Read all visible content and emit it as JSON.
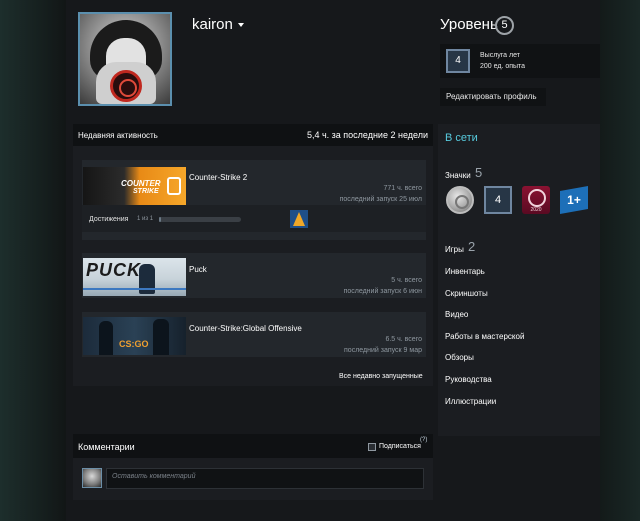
{
  "profile": {
    "username": "kairon",
    "level_label": "Уровень",
    "level": "5",
    "xp_badge_level": "4",
    "xp_line1": "Выслуга лет",
    "xp_line2": "200 ед. опыта",
    "edit_label": "Редактировать профиль"
  },
  "activity": {
    "title": "Недавняя активность",
    "stat": "5,4 ч. за последние 2 недели",
    "cs2_cover_text1": "COUNTER",
    "cs2_cover_text2": "STRIKE",
    "puck_cover_text": "PUCK",
    "csgo_cover_text": "CS:GO",
    "games": [
      {
        "name": "Counter-Strike 2",
        "hours": "771 ч. всего",
        "last": "последний запуск 25 июл"
      },
      {
        "name": "Puck",
        "hours": "5 ч. всего",
        "last": "последний запуск 6 июн"
      },
      {
        "name": "Counter-Strike:Global Offensive",
        "hours": "6.5 ч. всего",
        "last": "последний запуск 9 мар"
      }
    ],
    "achievements_label": "Достижения",
    "achievements_count": "1 из 1",
    "achievements_progress": 0.02,
    "recent_link": "Все недавно запущенные"
  },
  "comments": {
    "title": "Комментарии",
    "subscribe_label": "Подписаться",
    "help": "(?)",
    "placeholder": "Оставить комментарий"
  },
  "sidebar": {
    "status": "В сети",
    "badges_label": "Значки",
    "badges_count": "5",
    "badge_level": "4",
    "badge_year": "2020",
    "badge_plus": "1+",
    "games_label": "Игры",
    "games_count": "2",
    "links": [
      "Инвентарь",
      "Скриншоты",
      "Видео",
      "Работы в мастерской",
      "Обзоры",
      "Руководства",
      "Иллюстрации"
    ]
  },
  "colors": {
    "online": "#57cbde",
    "avatar_border": "#5b8fae",
    "background": "#16181b"
  }
}
